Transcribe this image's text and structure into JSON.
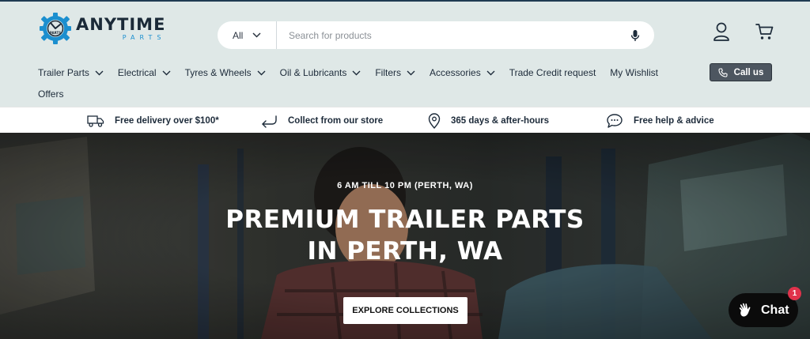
{
  "brand": {
    "name": "ANYTIME",
    "sub": "PARTS",
    "gear_label": "PARTS"
  },
  "search": {
    "category": "All",
    "placeholder": "Search for products"
  },
  "icons": {
    "account": "user-icon",
    "cart": "cart-icon",
    "mic": "microphone-icon",
    "phone": "phone-icon"
  },
  "nav": {
    "items": [
      {
        "label": "Trailer Parts",
        "dropdown": true
      },
      {
        "label": "Electrical",
        "dropdown": true
      },
      {
        "label": "Tyres & Wheels",
        "dropdown": true
      },
      {
        "label": "Oil & Lubricants",
        "dropdown": true
      },
      {
        "label": "Filters",
        "dropdown": true
      },
      {
        "label": "Accessories",
        "dropdown": true
      },
      {
        "label": "Trade Credit request",
        "dropdown": false
      },
      {
        "label": "My Wishlist",
        "dropdown": false
      }
    ],
    "offers": "Offers",
    "call_us": "Call us"
  },
  "features": [
    {
      "icon": "truck-icon",
      "label": "Free delivery over $100*"
    },
    {
      "icon": "return-arrow-icon",
      "label": "Collect from our store"
    },
    {
      "icon": "location-pin-icon",
      "label": "365 days & after-hours"
    },
    {
      "icon": "chat-bubble-icon",
      "label": "Free help & advice"
    }
  ],
  "hero": {
    "pretitle": "6 AM TILL 10 PM (PERTH, WA)",
    "title_line1": "PREMIUM TRAILER PARTS",
    "title_line2": "IN PERTH, WA",
    "cta": "EXPLORE COLLECTIONS"
  },
  "chat": {
    "label": "Chat",
    "badge": "1"
  },
  "colors": {
    "header_bg": "#dfe8e7",
    "brand_dark": "#1b2a38",
    "brand_blue": "#1c8fcf",
    "call_button": "#4d5660",
    "chat_badge": "#e0324b"
  }
}
